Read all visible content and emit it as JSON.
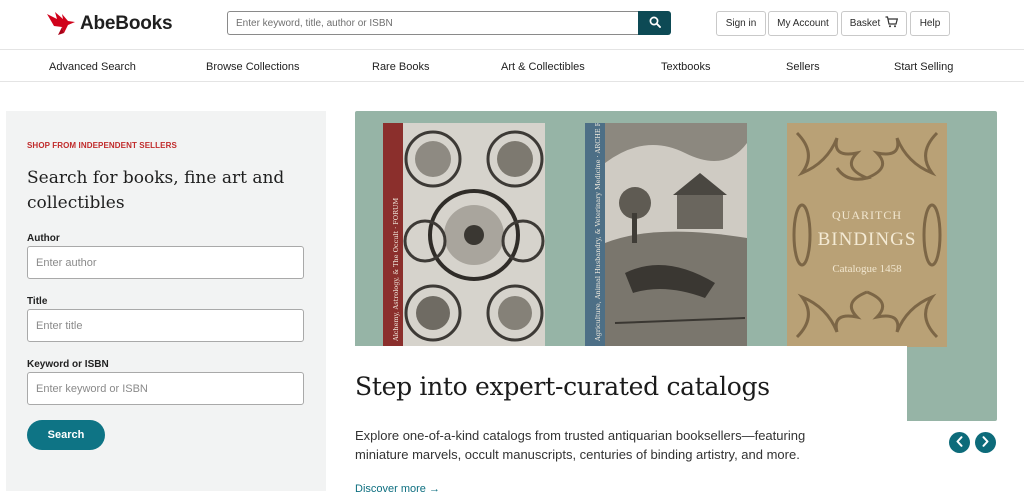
{
  "header": {
    "logo_text": "AbeBooks",
    "search_placeholder": "Enter keyword, title, author or ISBN",
    "search_icon": "search-icon",
    "buttons": {
      "sign_in": "Sign in",
      "my_account": "My Account",
      "basket": "Basket",
      "help": "Help"
    },
    "basket_icon": "cart-icon"
  },
  "nav": {
    "items": [
      {
        "label": "Advanced Search"
      },
      {
        "label": "Browse Collections"
      },
      {
        "label": "Rare Books"
      },
      {
        "label": "Art & Collectibles"
      },
      {
        "label": "Textbooks"
      },
      {
        "label": "Sellers"
      },
      {
        "label": "Start Selling"
      }
    ]
  },
  "search_panel": {
    "kicker": "SHOP FROM INDEPENDENT SELLERS",
    "title": "Search for books, fine art and collectibles",
    "author_label": "Author",
    "author_placeholder": "Enter author",
    "title_label": "Title",
    "title_placeholder": "Enter title",
    "keyword_label": "Keyword or ISBN",
    "keyword_placeholder": "Enter keyword or ISBN",
    "search_button": "Search"
  },
  "hero": {
    "background_color": "#96b4a6",
    "books": [
      {
        "spine_text": "Alchemy, Astrology, & The Occult · FORUM",
        "spine_color": "#8b2f2c"
      },
      {
        "spine_text": "Agriculture, Animal Husbandry, & Veterinary Medicine · ARCHE Rare Books",
        "spine_color": "#4d6f86"
      },
      {
        "title_top": "QUARITCH",
        "title_main": "BINDINGS",
        "title_sub": "Catalogue 1458"
      }
    ],
    "headline": "Step into expert-curated catalogs",
    "description": "Explore one-of-a-kind catalogs from trusted antiquarian booksellers—featuring miniature marvels, occult manuscripts, centuries of binding artistry, and more.",
    "link_text": "Discover more →",
    "prev_icon": "chevron-left-icon",
    "next_icon": "chevron-right-icon"
  },
  "colors": {
    "brand_red": "#d0021b",
    "accent_teal": "#0e7485",
    "dark_teal": "#0d4a55",
    "kicker_red": "#c02b2b"
  }
}
